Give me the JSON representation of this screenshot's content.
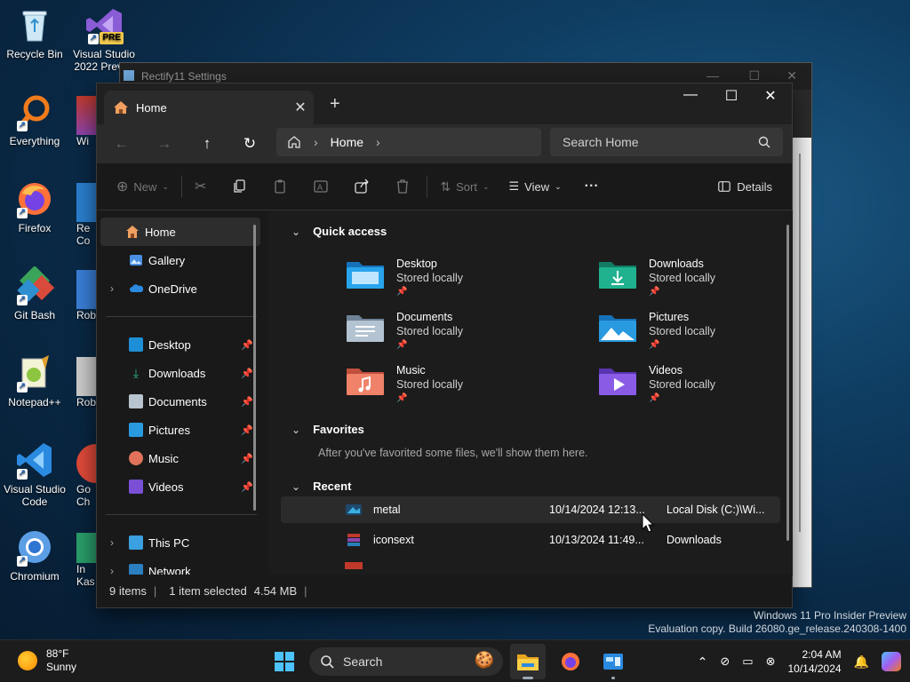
{
  "desktop_icons": [
    {
      "id": "recycle-bin",
      "label": "Recycle Bin"
    },
    {
      "id": "visual-studio-2022",
      "label": "Visual Studio 2022 Previ..."
    },
    {
      "id": "everything",
      "label": "Everything"
    },
    {
      "id": "firefox",
      "label": "Firefox"
    },
    {
      "id": "git-bash",
      "label": "Git Bash"
    },
    {
      "id": "notepadpp",
      "label": "Notepad++"
    },
    {
      "id": "vscode",
      "label": "Visual Studio Code"
    },
    {
      "id": "chromium",
      "label": "Chromium"
    }
  ],
  "behind_icons": [
    "Wi",
    "Re Co",
    "Roblo",
    "Roblo",
    "Go Ch",
    "In Kas"
  ],
  "background_window": {
    "title": "Rectify11 Settings"
  },
  "explorer": {
    "tab_title": "Home",
    "new_tab": "+",
    "breadcrumb": "Home",
    "search_placeholder": "Search Home",
    "toolbar": {
      "new": "New",
      "sort": "Sort",
      "view": "View",
      "more": "···",
      "details": "Details"
    },
    "sidebar": {
      "home": "Home",
      "gallery": "Gallery",
      "onedrive": "OneDrive",
      "pinned": [
        "Desktop",
        "Downloads",
        "Documents",
        "Pictures",
        "Music",
        "Videos"
      ],
      "this_pc": "This PC",
      "network": "Network"
    },
    "sections": {
      "quick_access": "Quick access",
      "favorites": "Favorites",
      "favorites_empty": "After you've favorited some files, we'll show them here.",
      "recent": "Recent"
    },
    "quick_access": [
      {
        "name": "Desktop",
        "status": "Stored locally",
        "color": "#1e8fd6"
      },
      {
        "name": "Downloads",
        "status": "Stored locally",
        "color": "#1fa88a"
      },
      {
        "name": "Documents",
        "status": "Stored locally",
        "color": "#8ea4b8"
      },
      {
        "name": "Pictures",
        "status": "Stored locally",
        "color": "#2a9ae0"
      },
      {
        "name": "Music",
        "status": "Stored locally",
        "color": "#e0735a"
      },
      {
        "name": "Videos",
        "status": "Stored locally",
        "color": "#7a4fd6"
      }
    ],
    "recent": [
      {
        "name": "metal",
        "date": "10/14/2024 12:13...",
        "location": "Local Disk (C:)\\Wi..."
      },
      {
        "name": "iconsext",
        "date": "10/13/2024 11:49...",
        "location": "Downloads"
      }
    ],
    "status": {
      "items": "9 items",
      "selected": "1 item selected",
      "size": "4.54 MB",
      "sep": "|"
    }
  },
  "watermark": {
    "line1": "Windows 11 Pro Insider Preview",
    "line2": "Evaluation copy. Build 26080.ge_release.240308-1400"
  },
  "taskbar": {
    "temp": "88°F",
    "condition": "Sunny",
    "search": "Search",
    "time": "2:04 AM",
    "date": "10/14/2024"
  }
}
